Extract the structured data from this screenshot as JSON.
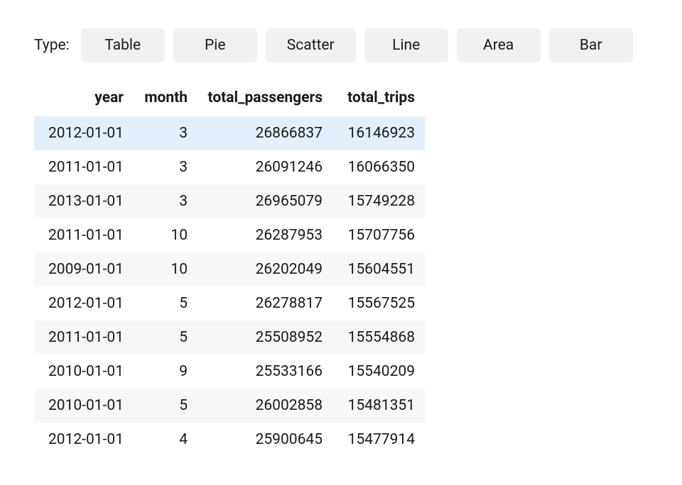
{
  "typeSelector": {
    "label": "Type:",
    "options": [
      "Table",
      "Pie",
      "Scatter",
      "Line",
      "Area",
      "Bar"
    ]
  },
  "chart_data": {
    "type": "table",
    "columns": [
      "year",
      "month",
      "total_passengers",
      "total_trips"
    ],
    "rows": [
      {
        "year": "2012-01-01",
        "month": 3,
        "total_passengers": 26866837,
        "total_trips": 16146923,
        "highlight": true
      },
      {
        "year": "2011-01-01",
        "month": 3,
        "total_passengers": 26091246,
        "total_trips": 16066350
      },
      {
        "year": "2013-01-01",
        "month": 3,
        "total_passengers": 26965079,
        "total_trips": 15749228
      },
      {
        "year": "2011-01-01",
        "month": 10,
        "total_passengers": 26287953,
        "total_trips": 15707756
      },
      {
        "year": "2009-01-01",
        "month": 10,
        "total_passengers": 26202049,
        "total_trips": 15604551
      },
      {
        "year": "2012-01-01",
        "month": 5,
        "total_passengers": 26278817,
        "total_trips": 15567525
      },
      {
        "year": "2011-01-01",
        "month": 5,
        "total_passengers": 25508952,
        "total_trips": 15554868
      },
      {
        "year": "2010-01-01",
        "month": 9,
        "total_passengers": 25533166,
        "total_trips": 15540209
      },
      {
        "year": "2010-01-01",
        "month": 5,
        "total_passengers": 26002858,
        "total_trips": 15481351
      },
      {
        "year": "2012-01-01",
        "month": 4,
        "total_passengers": 25900645,
        "total_trips": 15477914
      }
    ]
  }
}
